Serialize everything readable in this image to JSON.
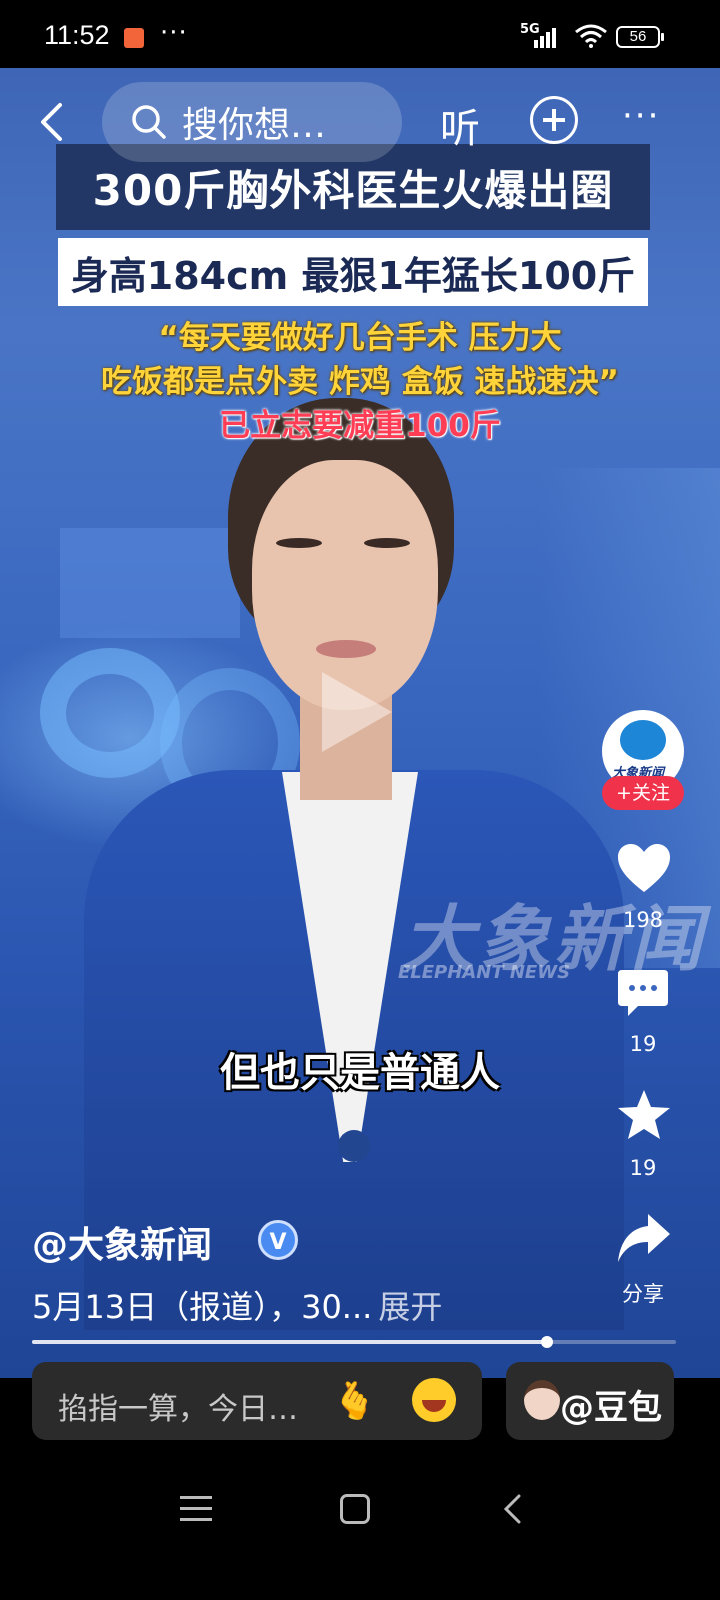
{
  "status_bar": {
    "time": "11:52",
    "more": "···",
    "network": "5G",
    "battery": "56"
  },
  "top_nav": {
    "search_placeholder": "搜你想…",
    "listen_label": "听"
  },
  "captions": {
    "title": "300斤胸外科医生火爆出圈",
    "subtitle": "身高184cm 最狠1年猛长100斤",
    "quote_line1": "“每天要做好几台手术 压力大",
    "quote_line2": "吃饭都是点外卖 炸鸡 盒饭 速战速决”",
    "quote_line3": "已立志要减重100斤"
  },
  "watermark": {
    "cn": "大象新闻",
    "en": "ELEPHANT NEWS"
  },
  "video_subtitle": "但也只是普通人",
  "right_rail": {
    "account_logo_text": "大象新闻",
    "follow_label": "+关注",
    "likes": "198",
    "comments": "19",
    "favorites": "19",
    "share_label": "分享"
  },
  "post": {
    "author": "@大象新闻",
    "verified_badge": "V",
    "description": "5月13日（报道），30...",
    "expand_label": "展开",
    "progress": 0.8
  },
  "bottom_bar": {
    "ask_placeholder": "掐指一算，今日…",
    "doubao_label": "@豆包"
  },
  "icons": {
    "back": "chevron-left-icon",
    "search": "search-icon",
    "add": "plus-circle-icon",
    "more": "more-dots-icon",
    "like": "heart-icon",
    "comment": "comment-icon",
    "favorite": "star-icon",
    "share": "share-arrow-icon"
  }
}
